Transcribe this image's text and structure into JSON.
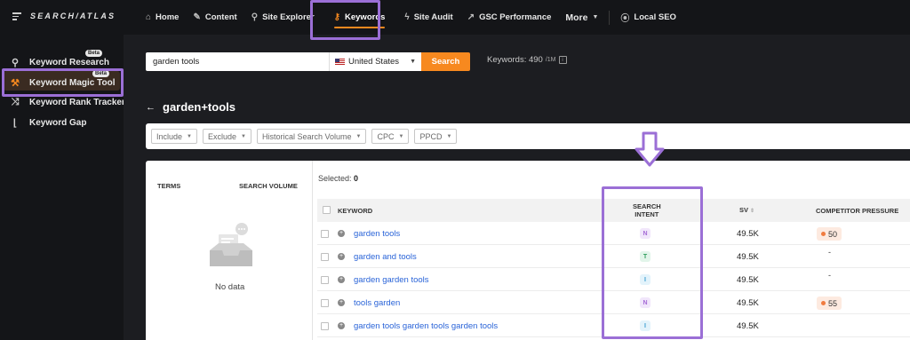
{
  "brand": {
    "logo_text": "SEARCH/ATLAS"
  },
  "nav": {
    "items": [
      {
        "label": "Home",
        "icon": "home-icon"
      },
      {
        "label": "Content",
        "icon": "pen-icon"
      },
      {
        "label": "Site Explorer",
        "icon": "search-icon"
      },
      {
        "label": "Keywords",
        "icon": "key-icon"
      },
      {
        "label": "Site Audit",
        "icon": "bolt-icon"
      },
      {
        "label": "GSC Performance",
        "icon": "chart-icon"
      },
      {
        "label": "More",
        "icon": "chevron-down-icon"
      },
      {
        "label": "Local SEO",
        "icon": "pin-icon"
      }
    ],
    "active": "Keywords"
  },
  "sidebar": {
    "items": [
      {
        "label": "Keyword Research",
        "icon": "search-icon",
        "badge": "Beta"
      },
      {
        "label": "Keyword Magic Tool",
        "icon": "wand-icon",
        "badge": "Beta"
      },
      {
        "label": "Keyword Rank Tracker",
        "icon": "shuffle-icon"
      },
      {
        "label": "Keyword Gap",
        "icon": "chart-icon"
      }
    ]
  },
  "search": {
    "value": "garden tools",
    "country": "United States",
    "button_label": "Search",
    "keywords_label": "Keywords: 490",
    "keywords_limit": "/1M"
  },
  "page": {
    "back_title": "garden+tools"
  },
  "filters": [
    "Include",
    "Exclude",
    "Historical Search Volume",
    "CPC",
    "PPCD"
  ],
  "terms": {
    "header_terms": "TERMS",
    "header_volume": "SEARCH VOLUME",
    "empty_text": "No data"
  },
  "table": {
    "selected_label": "Selected:",
    "selected_count": "0",
    "headers": {
      "keyword": "KEYWORD",
      "intent_line1": "SEARCH",
      "intent_line2": "INTENT",
      "sv": "SV",
      "competitor": "COMPETITOR PRESSURE"
    },
    "rows": [
      {
        "keyword": "garden tools",
        "intent": "N",
        "sv": "49.5K",
        "pressure": "50"
      },
      {
        "keyword": "garden and tools",
        "intent": "T",
        "sv": "49.5K",
        "pressure": "-"
      },
      {
        "keyword": "garden garden tools",
        "intent": "I",
        "sv": "49.5K",
        "pressure": "-"
      },
      {
        "keyword": "tools garden",
        "intent": "N",
        "sv": "49.5K",
        "pressure": "55"
      },
      {
        "keyword": "garden tools garden tools garden tools",
        "intent": "I",
        "sv": "49.5K",
        "pressure": ""
      }
    ]
  },
  "colors": {
    "accent": "#f7891f",
    "highlight": "#9b6fd6",
    "intent_N": "#f1e6fb",
    "intent_T": "#e2f5ea",
    "intent_I": "#e3f3fb"
  }
}
